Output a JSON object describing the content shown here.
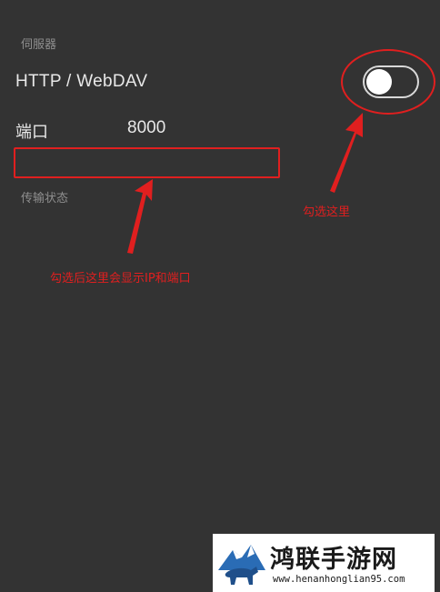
{
  "server_section": {
    "title": "伺服器",
    "http_webdav_label": "HTTP / WebDAV",
    "http_webdav_enabled": false,
    "port_label": "端口",
    "port_value": "8000",
    "ip_port_value": "",
    "transfer_status_label": "传输状态"
  },
  "annotations": {
    "check_here": "勾选这里",
    "after_check": "勾选后这里会显示IP和端口",
    "color": "#e01f1f"
  },
  "watermark": {
    "name": "鸿联手游网",
    "url": "www.henanhonglian95.com"
  }
}
